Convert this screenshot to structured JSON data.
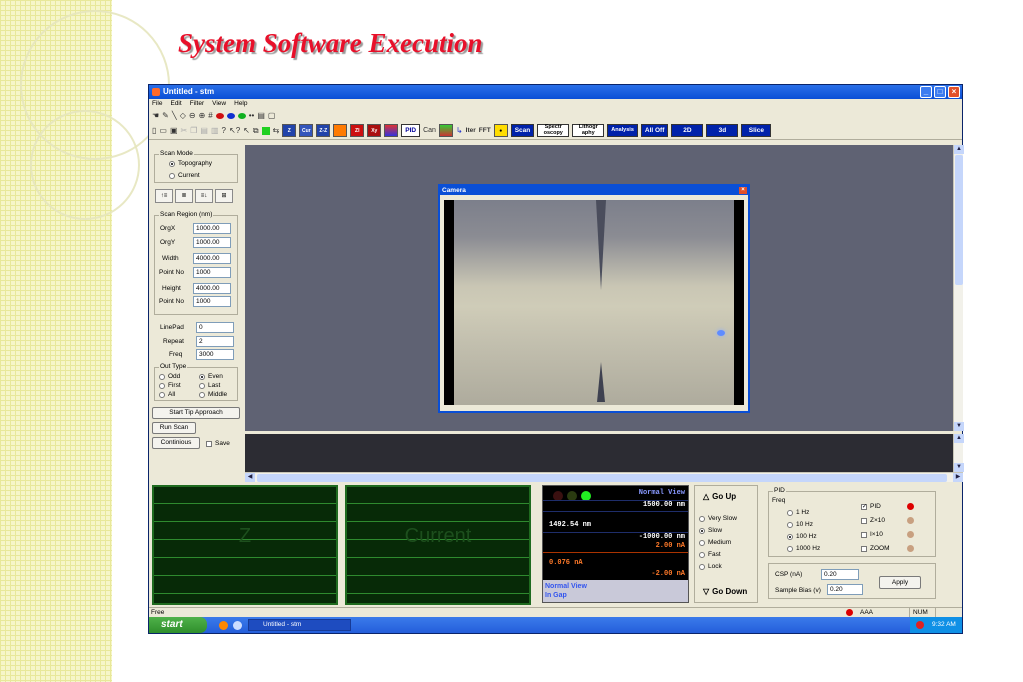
{
  "slide": {
    "title": "System Software Execution"
  },
  "window": {
    "title": "Untitled - stm"
  },
  "menu": [
    "File",
    "Edit",
    "Filter",
    "View",
    "Help"
  ],
  "toolbar": {
    "pid": "PID",
    "scan_icon": "Can",
    "filter": "Iter",
    "fft": "FFT",
    "scan": "Scan",
    "spectroscopy": "Spectr oscopy",
    "lithography": "Lithogr aphy",
    "analysis": "Analysis",
    "all_off": "All Off",
    "view_2d": "2D",
    "view_3d": "3d",
    "slice": "Slice",
    "icon_labels": [
      "Z",
      "Cur",
      "Z-Z",
      "ZI",
      "Xy"
    ]
  },
  "scan_mode": {
    "label": "Scan Mode",
    "options": [
      "Topography",
      "Current"
    ],
    "selected": "Topography"
  },
  "scan_region": {
    "label": "Scan Region (nm)",
    "fields": [
      {
        "label": "OrgX",
        "value": "1000.00"
      },
      {
        "label": "OrgY",
        "value": "1000.00"
      },
      {
        "label": "Width",
        "value": "4000.00"
      },
      {
        "label": "Point No",
        "value": "1000"
      },
      {
        "label": "Height",
        "value": "4000.00"
      },
      {
        "label": "Point No",
        "value": "1000"
      }
    ]
  },
  "line_params": {
    "fields": [
      {
        "label": "LinePad",
        "value": "0"
      },
      {
        "label": "Repeat",
        "value": "2"
      },
      {
        "label": "Freq",
        "value": "3000"
      }
    ]
  },
  "out_type": {
    "label": "Out Type",
    "options": [
      "Odd",
      "Even",
      "First",
      "Last",
      "All",
      "Middle"
    ],
    "selected": "Even"
  },
  "buttons": {
    "start_tip_approach": "Start Tip Approach",
    "run_scan": "Run Scan",
    "continuous": "Continious",
    "save": "Save"
  },
  "camera": {
    "title": "Camera"
  },
  "scopes": {
    "z": "Z",
    "current": "Current"
  },
  "meter": {
    "header": "Normal View",
    "top_value": "1500.00 nm",
    "position": "1492.54 nm",
    "bottom_value": "-1000.00 nm",
    "current_top": "2.00 nA",
    "current": "0.076 nA",
    "current_bottom": "-2.00 nA",
    "footer_line1": "Normal View",
    "footer_line2": "In Gap"
  },
  "speed": {
    "go_up": "Go Up",
    "go_down": "Go Down",
    "options": [
      "Very Slow",
      "Slow",
      "Medium",
      "Fast",
      "Lock"
    ],
    "selected": "Slow"
  },
  "pid": {
    "label": "PID",
    "freq_label": "Freq",
    "freq_options": [
      "1 Hz",
      "10 Hz",
      "100 Hz",
      "1000 Hz"
    ],
    "freq_selected": "100 Hz",
    "toggles": [
      {
        "label": "PID",
        "checked": true
      },
      {
        "label": "Z×10",
        "checked": false
      },
      {
        "label": "I×10",
        "checked": false
      },
      {
        "label": "ZOOM",
        "checked": false
      }
    ]
  },
  "csp": {
    "csp_label": "CSP (nA)",
    "csp_value": "0.20",
    "bias_label": "Sample Bias (v)",
    "bias_value": "0.20",
    "apply": "Apply"
  },
  "status": {
    "left": "Free",
    "aaa": "AAA",
    "num": "NUM"
  },
  "taskbar": {
    "start": "start",
    "task": "Untitled - stm",
    "clock": "9:32 AM"
  },
  "colors": {
    "title_red": "#e8102a",
    "xp_blue": "#0a4fd6",
    "scope_green": "#1f6b1f",
    "meter_blue": "#3355ee"
  }
}
